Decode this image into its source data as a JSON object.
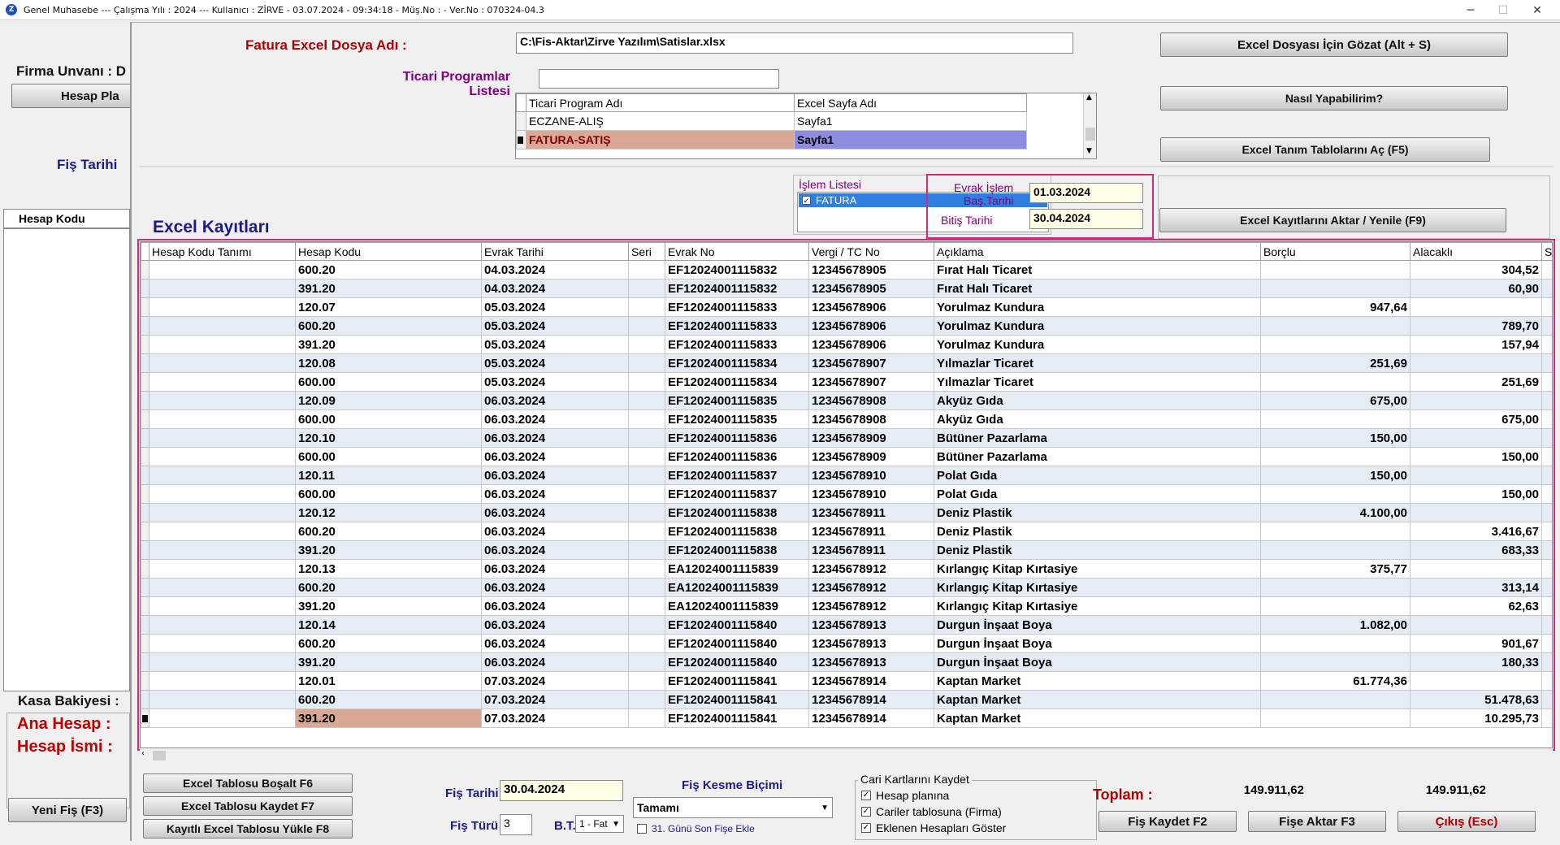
{
  "titlebar": {
    "text": "Genel Muhasebe  ---  Çalışma Yılı : 2024  ---  Kullanıcı : ZİRVE - 03.07.2024 - 09:34:18 - Müş.No :  - Ver.No : 070324-04.3",
    "minimize": "─",
    "maximize": "☐",
    "close": "✕"
  },
  "background": {
    "firma_unvani_label": "Firma Unvanı : D",
    "hesap_plani_btn": "Hesap Pla",
    "fis_tarihi_label": "Fiş Tarihi",
    "hesap_kodu_header": "Hesap Kodu",
    "kasa_bakiyesi_label": "Kasa Bakiyesi :",
    "ana_hesap_label": "Ana Hesap :",
    "hesap_ismi_label": "Hesap İsmi :",
    "yeni_fis_btn": "Yeni Fiş (F3)"
  },
  "dialog": {
    "file_label": "Fatura Excel Dosya Adı :",
    "file_path": "C:\\Fis-Aktar\\Zirve Yazılım\\Satislar.xlsx",
    "browse_btn": "Excel Dosyası İçin Gözat (Alt + S)",
    "how_btn": "Nasıl Yapabilirim?",
    "open_tables_btn": "Excel Tanım Tablolarını Aç (F5)",
    "programs_label_1": "Ticari Programlar",
    "programs_label_2": "Listesi",
    "programs_search": "",
    "programs_grid": {
      "headers": [
        "Ticari Program Adı",
        "Excel Sayfa Adı"
      ],
      "rows": [
        {
          "program": "ECZANE-ALIŞ",
          "sheet": "Sayfa1",
          "selected": false
        },
        {
          "program": "FATURA-SATIŞ",
          "sheet": "Sayfa1",
          "selected": true
        }
      ]
    },
    "islem_listesi_label": "İşlem Listesi",
    "islem_item": "FATURA",
    "date_start_label_1": "Evrak İşlem",
    "date_start_label_2": "Baş.Tarihi",
    "date_start": "01.03.2024",
    "date_end_label": "Bitiş Tarihi",
    "date_end": "30.04.2024",
    "transfer_btn": "Excel Kayıtlarını Aktar / Yenile (F9)",
    "excel_records_title": "Excel Kayıtları",
    "grid_headers": [
      "Hesap Kodu Tanımı",
      "Hesap Kodu",
      "Evrak Tarihi",
      "Seri",
      "Evrak No",
      "Vergi / TC No",
      "Açıklama",
      "Borçlu",
      "Alacaklı",
      "Sto"
    ],
    "grid_rows": [
      {
        "tanim": "",
        "kod": "600.20",
        "tarih": "04.03.2024",
        "seri": "",
        "evrak": "EF12024001115832",
        "vergi": "12345678905",
        "aciklama": "Fırat Halı Ticaret",
        "borc": "",
        "alacak": "304,52"
      },
      {
        "tanim": "",
        "kod": "391.20",
        "tarih": "04.03.2024",
        "seri": "",
        "evrak": "EF12024001115832",
        "vergi": "12345678905",
        "aciklama": "Fırat Halı Ticaret",
        "borc": "",
        "alacak": "60,90"
      },
      {
        "tanim": "",
        "kod": "120.07",
        "tarih": "05.03.2024",
        "seri": "",
        "evrak": "EF12024001115833",
        "vergi": "12345678906",
        "aciklama": "Yorulmaz Kundura",
        "borc": "947,64",
        "alacak": ""
      },
      {
        "tanim": "",
        "kod": "600.20",
        "tarih": "05.03.2024",
        "seri": "",
        "evrak": "EF12024001115833",
        "vergi": "12345678906",
        "aciklama": "Yorulmaz Kundura",
        "borc": "",
        "alacak": "789,70"
      },
      {
        "tanim": "",
        "kod": "391.20",
        "tarih": "05.03.2024",
        "seri": "",
        "evrak": "EF12024001115833",
        "vergi": "12345678906",
        "aciklama": "Yorulmaz Kundura",
        "borc": "",
        "alacak": "157,94"
      },
      {
        "tanim": "",
        "kod": "120.08",
        "tarih": "05.03.2024",
        "seri": "",
        "evrak": "EF12024001115834",
        "vergi": "12345678907",
        "aciklama": "Yılmazlar Ticaret",
        "borc": "251,69",
        "alacak": ""
      },
      {
        "tanim": "",
        "kod": "600.00",
        "tarih": "05.03.2024",
        "seri": "",
        "evrak": "EF12024001115834",
        "vergi": "12345678907",
        "aciklama": "Yılmazlar Ticaret",
        "borc": "",
        "alacak": "251,69"
      },
      {
        "tanim": "",
        "kod": "120.09",
        "tarih": "06.03.2024",
        "seri": "",
        "evrak": "EF12024001115835",
        "vergi": "12345678908",
        "aciklama": "Akyüz Gıda",
        "borc": "675,00",
        "alacak": ""
      },
      {
        "tanim": "",
        "kod": "600.00",
        "tarih": "06.03.2024",
        "seri": "",
        "evrak": "EF12024001115835",
        "vergi": "12345678908",
        "aciklama": "Akyüz Gıda",
        "borc": "",
        "alacak": "675,00"
      },
      {
        "tanim": "",
        "kod": "120.10",
        "tarih": "06.03.2024",
        "seri": "",
        "evrak": "EF12024001115836",
        "vergi": "12345678909",
        "aciklama": "Bütüner Pazarlama",
        "borc": "150,00",
        "alacak": ""
      },
      {
        "tanim": "",
        "kod": "600.00",
        "tarih": "06.03.2024",
        "seri": "",
        "evrak": "EF12024001115836",
        "vergi": "12345678909",
        "aciklama": "Bütüner Pazarlama",
        "borc": "",
        "alacak": "150,00"
      },
      {
        "tanim": "",
        "kod": "120.11",
        "tarih": "06.03.2024",
        "seri": "",
        "evrak": "EF12024001115837",
        "vergi": "12345678910",
        "aciklama": "Polat Gıda",
        "borc": "150,00",
        "alacak": ""
      },
      {
        "tanim": "",
        "kod": "600.00",
        "tarih": "06.03.2024",
        "seri": "",
        "evrak": "EF12024001115837",
        "vergi": "12345678910",
        "aciklama": "Polat Gıda",
        "borc": "",
        "alacak": "150,00"
      },
      {
        "tanim": "",
        "kod": "120.12",
        "tarih": "06.03.2024",
        "seri": "",
        "evrak": "EF12024001115838",
        "vergi": "12345678911",
        "aciklama": "Deniz Plastik",
        "borc": "4.100,00",
        "alacak": ""
      },
      {
        "tanim": "",
        "kod": "600.20",
        "tarih": "06.03.2024",
        "seri": "",
        "evrak": "EF12024001115838",
        "vergi": "12345678911",
        "aciklama": "Deniz Plastik",
        "borc": "",
        "alacak": "3.416,67"
      },
      {
        "tanim": "",
        "kod": "391.20",
        "tarih": "06.03.2024",
        "seri": "",
        "evrak": "EF12024001115838",
        "vergi": "12345678911",
        "aciklama": "Deniz Plastik",
        "borc": "",
        "alacak": "683,33"
      },
      {
        "tanim": "",
        "kod": "120.13",
        "tarih": "06.03.2024",
        "seri": "",
        "evrak": "EA12024001115839",
        "vergi": "12345678912",
        "aciklama": "Kırlangıç Kitap Kırtasiye",
        "borc": "375,77",
        "alacak": ""
      },
      {
        "tanim": "",
        "kod": "600.20",
        "tarih": "06.03.2024",
        "seri": "",
        "evrak": "EA12024001115839",
        "vergi": "12345678912",
        "aciklama": "Kırlangıç Kitap Kırtasiye",
        "borc": "",
        "alacak": "313,14"
      },
      {
        "tanim": "",
        "kod": "391.20",
        "tarih": "06.03.2024",
        "seri": "",
        "evrak": "EA12024001115839",
        "vergi": "12345678912",
        "aciklama": "Kırlangıç Kitap Kırtasiye",
        "borc": "",
        "alacak": "62,63"
      },
      {
        "tanim": "",
        "kod": "120.14",
        "tarih": "06.03.2024",
        "seri": "",
        "evrak": "EF12024001115840",
        "vergi": "12345678913",
        "aciklama": "Durgun İnşaat Boya",
        "borc": "1.082,00",
        "alacak": ""
      },
      {
        "tanim": "",
        "kod": "600.20",
        "tarih": "06.03.2024",
        "seri": "",
        "evrak": "EF12024001115840",
        "vergi": "12345678913",
        "aciklama": "Durgun İnşaat Boya",
        "borc": "",
        "alacak": "901,67"
      },
      {
        "tanim": "",
        "kod": "391.20",
        "tarih": "06.03.2024",
        "seri": "",
        "evrak": "EF12024001115840",
        "vergi": "12345678913",
        "aciklama": "Durgun İnşaat Boya",
        "borc": "",
        "alacak": "180,33"
      },
      {
        "tanim": "",
        "kod": "120.01",
        "tarih": "07.03.2024",
        "seri": "",
        "evrak": "EF12024001115841",
        "vergi": "12345678914",
        "aciklama": "Kaptan Market",
        "borc": "61.774,36",
        "alacak": ""
      },
      {
        "tanim": "",
        "kod": "600.20",
        "tarih": "07.03.2024",
        "seri": "",
        "evrak": "EF12024001115841",
        "vergi": "12345678914",
        "aciklama": "Kaptan Market",
        "borc": "",
        "alacak": "51.478,63"
      },
      {
        "tanim": "",
        "kod": "391.20",
        "tarih": "07.03.2024",
        "seri": "",
        "evrak": "EF12024001115841",
        "vergi": "12345678914",
        "aciklama": "Kaptan Market",
        "borc": "",
        "alacak": "10.295,73"
      }
    ],
    "bottom": {
      "bosalt_btn": "Excel Tablosu Boşalt F6",
      "kaydet_btn": "Excel Tablosu Kaydet F7",
      "yukle_btn": "Kayıtlı Excel Tablosu Yükle F8",
      "fis_tarihi_label": "Fiş Tarihi",
      "fis_tarihi": "30.04.2024",
      "fis_turu_label": "Fiş Türü",
      "fis_turu": "3",
      "bt_label": "B.T.",
      "bt_value": "1 - Fat",
      "fis_kesme_label": "Fiş Kesme Biçimi",
      "fis_kesme_value": "Tamamı",
      "gun31_label": "31. Günü Son Fişe Ekle",
      "cari_group_label": "Cari Kartlarını Kaydet",
      "chk_hesap_plani": "Hesap planına",
      "chk_cariler": "Cariler tablosuna (Firma)",
      "chk_eklenen": "Eklenen Hesapları Göster",
      "toplam_label": "Toplam :",
      "toplam_borc": "149.911,62",
      "toplam_alacak": "149.911,62",
      "fis_kaydet_btn": "Fiş Kaydet F2",
      "fise_aktar_btn": "Fişe Aktar F3",
      "cikis_btn": "Çıkış (Esc)"
    }
  },
  "colors": {
    "accent_pink": "#cc2d7c",
    "label_red": "#b00000",
    "label_purple": "#800080",
    "label_blue": "#1a1a8c",
    "selected_row": "#d9a996",
    "selected_cell": "#8c8ce0"
  }
}
